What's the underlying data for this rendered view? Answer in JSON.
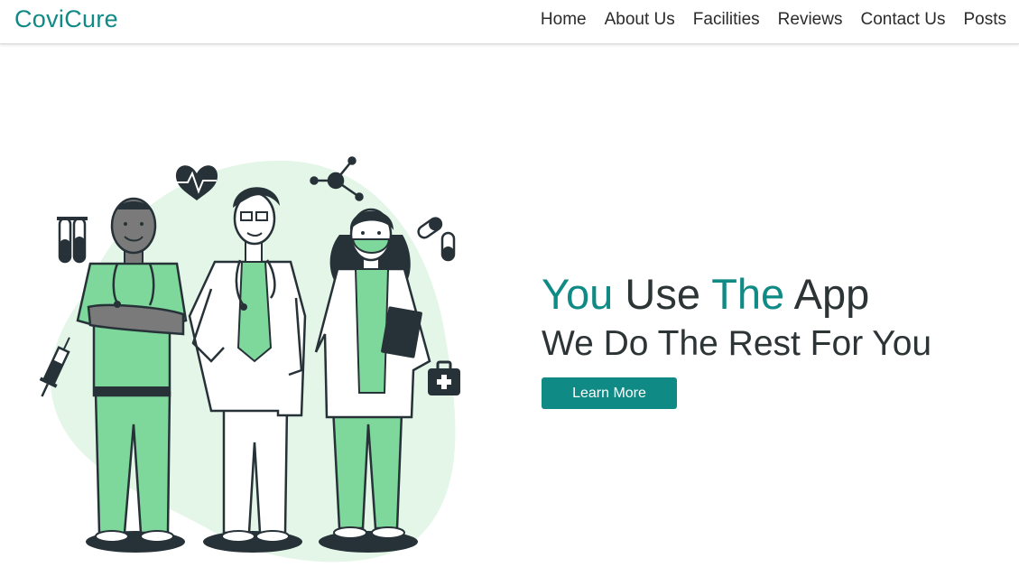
{
  "nav": {
    "brand": "CoviCure",
    "links": [
      "Home",
      "About Us",
      "Facilities",
      "Reviews",
      "Contact Us",
      "Posts"
    ]
  },
  "hero": {
    "headline_parts": [
      "You",
      "Use",
      "The",
      "App"
    ],
    "subline": "We Do The Rest For You",
    "cta_label": "Learn More"
  },
  "colors": {
    "accent": "#0f8a85",
    "scrubs": "#7fd89b",
    "blob": "#e3f6e8",
    "ink": "#263238"
  },
  "illustration": {
    "icons": [
      "test-tubes-icon",
      "heart-rate-icon",
      "molecule-icon",
      "pill-capsule-icon",
      "syringe-icon",
      "first-aid-kit-icon"
    ]
  }
}
